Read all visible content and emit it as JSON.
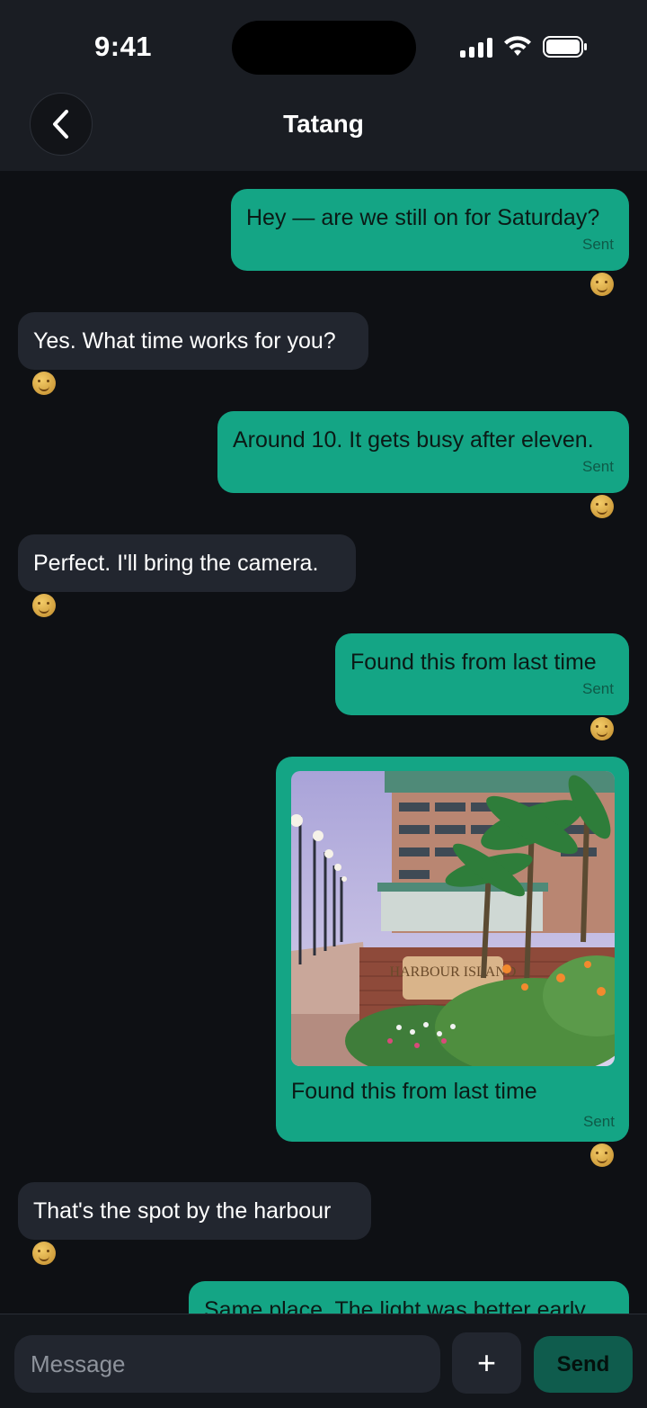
{
  "status_bar": {
    "time": "9:41"
  },
  "header": {
    "title": "Tatang"
  },
  "messages": [
    {
      "direction": "out",
      "text": "Hey — are we still on for Saturday?",
      "status": "Sent"
    },
    {
      "direction": "in",
      "text": "Yes. What time works for you?"
    },
    {
      "direction": "out",
      "text": "Around 10. It gets busy after eleven.",
      "status": "Sent"
    },
    {
      "direction": "in",
      "text": "Perfect. I'll bring the camera."
    },
    {
      "direction": "out",
      "text": "Found this from last time",
      "status": "Sent"
    },
    {
      "direction": "out",
      "image_sign": "HARBOUR ISLAND",
      "text": "Found this from last time",
      "status": "Sent"
    },
    {
      "direction": "in",
      "text": "That's the spot by the harbour"
    },
    {
      "direction": "out",
      "text": "Same place. The light was better early"
    }
  ],
  "composer": {
    "placeholder": "Message",
    "add_label": "+",
    "send_label": "Send"
  },
  "colors": {
    "outgoing_bubble": "#14a585",
    "incoming_bubble": "#22262f",
    "background": "#0e1014",
    "send_button": "#0f5c4d"
  },
  "icons": {
    "back": "chevron-left-icon",
    "reaction": "smiling-face-icon",
    "signal": "cellular-signal-icon",
    "wifi": "wifi-icon",
    "battery": "battery-icon"
  }
}
